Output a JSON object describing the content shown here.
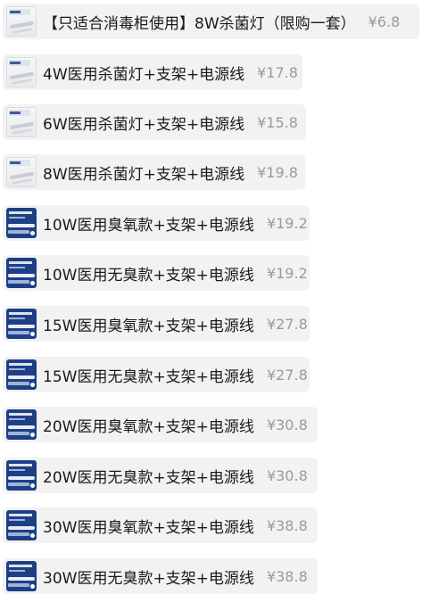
{
  "skus": [
    {
      "name": "【只适合消毒柜使用】8W杀菌灯（限购一套）",
      "price": "¥6.8",
      "thumb": "light"
    },
    {
      "name": "4W医用杀菌灯+支架+电源线",
      "price": "¥17.8",
      "thumb": "light"
    },
    {
      "name": "6W医用杀菌灯+支架+电源线",
      "price": "¥15.8",
      "thumb": "light"
    },
    {
      "name": "8W医用杀菌灯+支架+电源线",
      "price": "¥19.8",
      "thumb": "light"
    },
    {
      "name": "10W医用臭氧款+支架+电源线",
      "price": "¥19.2",
      "thumb": "dark"
    },
    {
      "name": "10W医用无臭款+支架+电源线",
      "price": "¥19.2",
      "thumb": "dark"
    },
    {
      "name": "15W医用臭氧款+支架+电源线",
      "price": "¥27.8",
      "thumb": "dark"
    },
    {
      "name": "15W医用无臭款+支架+电源线",
      "price": "¥27.8",
      "thumb": "dark"
    },
    {
      "name": "20W医用臭氧款+支架+电源线",
      "price": "¥30.8",
      "thumb": "dark"
    },
    {
      "name": "20W医用无臭款+支架+电源线",
      "price": "¥30.8",
      "thumb": "dark"
    },
    {
      "name": "30W医用臭氧款+支架+电源线",
      "price": "¥38.8",
      "thumb": "dark"
    },
    {
      "name": "30W医用无臭款+支架+电源线",
      "price": "¥38.8",
      "thumb": "dark"
    }
  ]
}
